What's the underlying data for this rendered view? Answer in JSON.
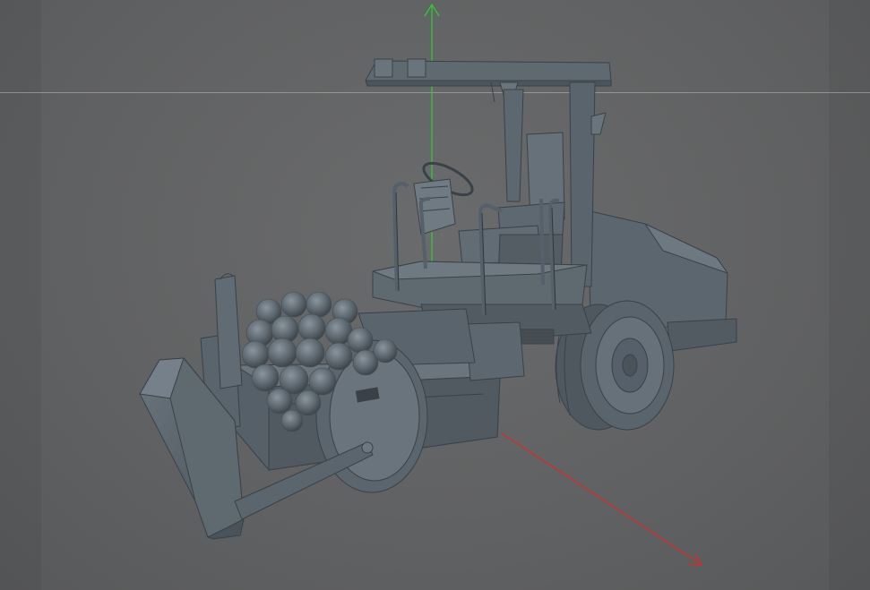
{
  "viewport": {
    "background_color": "#606162",
    "model_color": "#5a646c",
    "axis_colors": {
      "y": "#2bd12b",
      "x": "#d92a2a"
    },
    "icons": [
      "y-axis-arrow",
      "x-axis-arrow",
      "compactor-model"
    ]
  }
}
